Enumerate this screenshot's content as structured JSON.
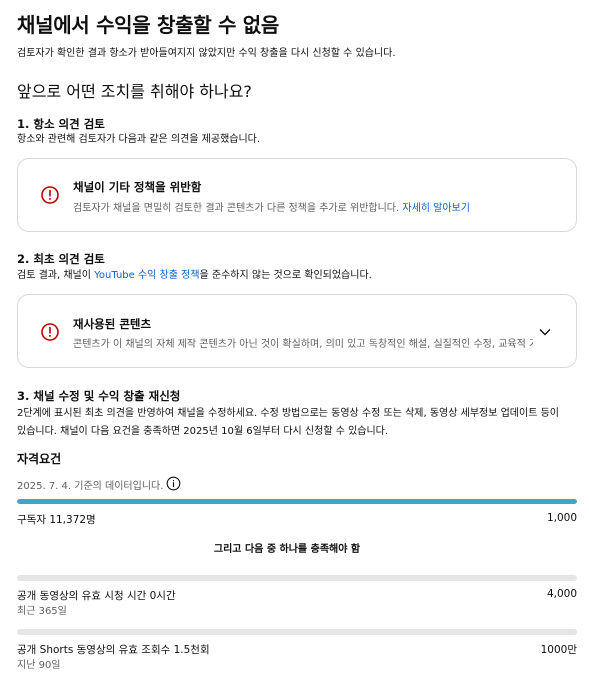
{
  "header": {
    "title": "채널에서 수익을 창출할 수 없음",
    "subtitle": "검토자가 확인한 결과 항소가 받아들여지지 않았지만 수익 창출을 다시 신청할 수 있습니다."
  },
  "next_steps": {
    "heading": "앞으로 어떤 조치를 취해야 하나요?"
  },
  "appeal_review": {
    "title": "1. 항소 의견 검토",
    "desc": "항소와 관련해 검토자가 다음과 같은 의견을 제공했습니다.",
    "card": {
      "icon": "error-circle-icon",
      "title": "채널이 기타 정책을 위반함",
      "desc": "검토자가 채널을 면밀히 검토한 결과 콘텐츠가 다른 정책을 추가로 위반합니다.",
      "link": "자세히 알아보기"
    }
  },
  "initial_review": {
    "title": "2. 최초 의견 검토",
    "desc_prefix": "검토 결과, 채널이 ",
    "desc_link": "YouTube 수익 창출 정책",
    "desc_suffix": "을 준수하지 않는 것으로 확인되었습니다.",
    "card": {
      "icon": "error-circle-icon",
      "title": "재사용된 콘텐츠",
      "desc": "콘텐츠가 이 채널의 자체 제작 콘텐츠가 아닌 것이 확실하며, 의미 있고 독창적인 해설, 실질적인 수정, 교육적 가치 등이 없습니다.",
      "expand_icon": "chevron-down-icon"
    }
  },
  "reapply": {
    "title": "3. 채널 수정 및 수익 창출 재신청",
    "line1": "2단계에 표시된 최초 의견을 반영하여 채널을 수정하세요. 수정 방법으로는 동영상 수정 또는 삭제, 동영상 세부정보 업데이트 등이",
    "line2": "있습니다. 채널이 다음 요건을 충족하면 2025년 10월 6일부터 다시 신청할 수 있습니다."
  },
  "requirements": {
    "heading": "자격요건",
    "as_of": "2025. 7. 4. 기준의 데이터입니다.",
    "info_icon": "info-icon",
    "subscribers": {
      "label": "구독자 11,372명",
      "target": "1,000",
      "progress": 1.0
    },
    "or_text": "그리고 다음 중 하나를 충족해야 함",
    "watch_time": {
      "label": "공개 동영상의 유효 시청 시간 0시간",
      "sub": "최근 365일",
      "target": "4,000",
      "progress": 0.0
    },
    "shorts_views": {
      "label": "공개 Shorts 동영상의 유효 조회수 1.5천회",
      "sub": "지난 90일",
      "target": "1000만",
      "progress": 0.0
    }
  },
  "colors": {
    "progress_fill": "#3ea6c8",
    "progress_track": "#e5e5e5",
    "link": "#065fd4",
    "error": "#c00000"
  }
}
